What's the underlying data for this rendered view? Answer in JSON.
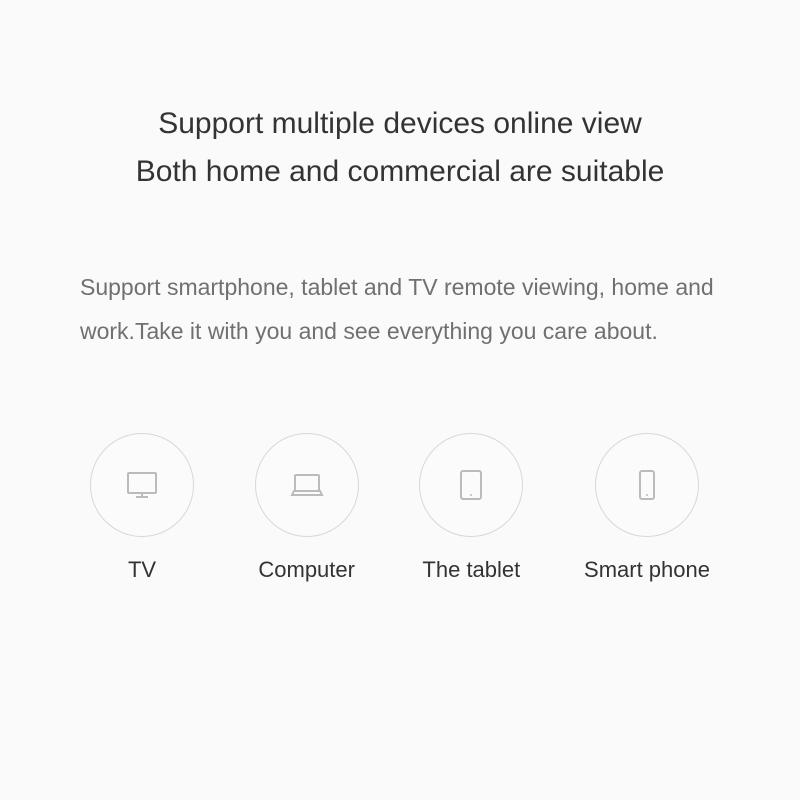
{
  "headings": {
    "line1": "Support multiple devices online view",
    "line2": "Both home and commercial are suitable"
  },
  "description": "Support smartphone, tablet and TV remote viewing, home and work.Take it with you and see everything you care about.",
  "devices": [
    {
      "label": "TV",
      "icon": "tv-icon"
    },
    {
      "label": "Computer",
      "icon": "laptop-icon"
    },
    {
      "label": "The tablet",
      "icon": "tablet-icon"
    },
    {
      "label": "Smart phone",
      "icon": "smartphone-icon"
    }
  ]
}
